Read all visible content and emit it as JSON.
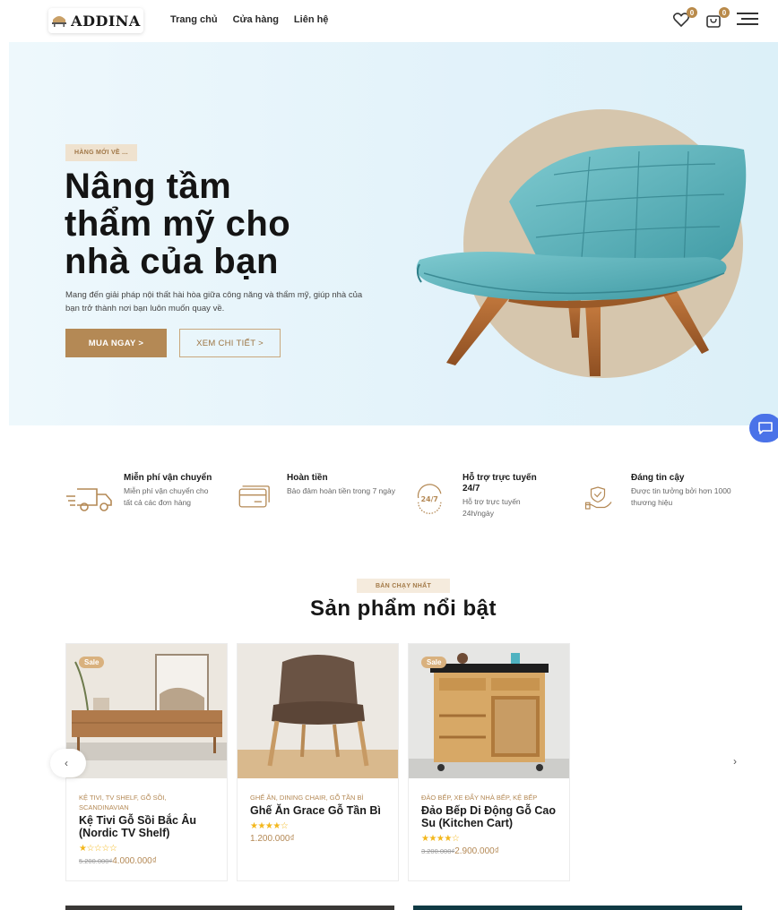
{
  "header": {
    "logo_text": "ADDINA",
    "nav": [
      "Trang chủ",
      "Cửa hàng",
      "Liên hệ"
    ],
    "wishlist_count": "0",
    "cart_count": "0"
  },
  "hero": {
    "tag": "HÀNG MỚI VỀ ...",
    "title_lines": [
      "Nâng tầm",
      "thẩm mỹ cho",
      "nhà của bạn"
    ],
    "description": "Mang đến giải pháp nội thất hài hòa giữa công năng và thẩm mỹ, giúp nhà của bạn trở thành nơi bạn luôn muốn quay về.",
    "primary_button": "MUA NGAY >",
    "secondary_button": "XEM CHI TIẾT >"
  },
  "features": [
    {
      "title": "Miễn phí vận chuyển",
      "desc": "Miễn phí vận chuyển cho tất cả các đơn hàng"
    },
    {
      "title": "Hoàn tiền",
      "desc": "Bảo đảm hoàn tiền trong 7 ngày"
    },
    {
      "title": "Hỗ trợ trực tuyến 24/7",
      "desc": "Hỗ trợ trực tuyến 24h/ngày",
      "icon_text": "24/7"
    },
    {
      "title": "Đáng tin cậy",
      "desc": "Được tin tưởng bởi hơn 1000 thương hiệu"
    }
  ],
  "section": {
    "tag": "BÁN CHẠY NHẤT",
    "title": "Sản phẩm nổi bật"
  },
  "products": [
    {
      "sale": "Sale",
      "category": "KỆ TIVI, TV SHELF, GỖ SỒI, SCANDINAVIAN",
      "name": "Kệ Tivi Gỗ Sồi Bắc Âu (Nordic TV Shelf)",
      "stars": "★☆☆☆☆",
      "old_price": "5.200.000₫",
      "price": "4.000.000₫",
      "rating": 1
    },
    {
      "sale": "",
      "category": "GHẾ ĂN, DINING CHAIR, GỖ TẦN BÌ",
      "name": "Ghế Ăn Grace Gỗ Tần Bì",
      "stars": "★★★★☆",
      "old_price": "",
      "price": "1.200.000₫",
      "rating": 4
    },
    {
      "sale": "Sale",
      "category": "ĐẢO BẾP, XE ĐẨY NHÀ BẾP, KỆ BẾP",
      "name": "Đảo Bếp Di Động Gỗ Cao Su (Kitchen Cart)",
      "stars": "★★★★☆",
      "old_price": "3.200.000₫",
      "price": "2.900.000₫",
      "rating": 4
    }
  ],
  "carousel": {
    "prev": "‹",
    "next": "›"
  },
  "colors": {
    "accent": "#b48955",
    "hero_bg": "#e2f2fa",
    "chat": "#4a72e8"
  }
}
